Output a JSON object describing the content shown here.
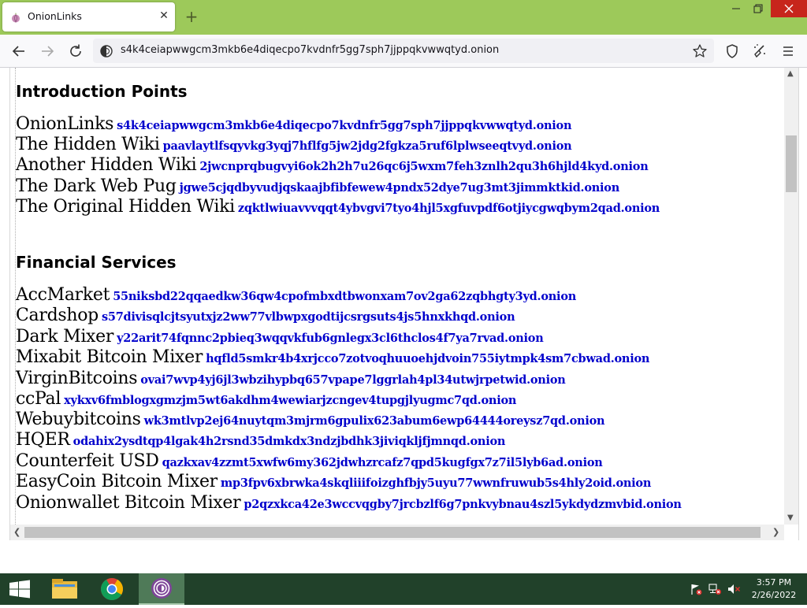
{
  "browser": {
    "tab_title": "OnionLinks",
    "url": "s4k4ceiapwwgcm3mkb6e4diqecpo7kvdnfr5gg7sph7jjppqkvwwqtyd.onion"
  },
  "sections": [
    {
      "heading": "Introduction Points",
      "entries": [
        {
          "name": "OnionLinks",
          "link": "s4k4ceiapwwgcm3mkb6e4diqecpo7kvdnfr5gg7sph7jjppqkvwwqtyd.onion"
        },
        {
          "name": "The Hidden Wiki",
          "link": "paavlaytlfsqyvkg3yqj7hflfg5jw2jdg2fgkza5ruf6lplwseeqtvyd.onion"
        },
        {
          "name": "Another Hidden Wiki",
          "link": "2jwcnprqbugvyi6ok2h2h7u26qc6j5wxm7feh3znlh2qu3h6hjld4kyd.onion"
        },
        {
          "name": "The Dark Web Pug",
          "link": "jgwe5cjqdbyvudjqskaajbfibfewew4pndx52dye7ug3mt3jimmktkid.onion"
        },
        {
          "name": "The Original Hidden Wiki",
          "link": "zqktlwiuavvvqqt4ybvgvi7tyo4hjl5xgfuvpdf6otjiycgwqbym2qad.onion"
        }
      ]
    },
    {
      "heading": "Financial Services",
      "entries": [
        {
          "name": "AccMarket",
          "link": "55niksbd22qqaedkw36qw4cpofmbxdtbwonxam7ov2ga62zqbhgty3yd.onion"
        },
        {
          "name": "Cardshop",
          "link": "s57divisqlcjtsyutxjz2ww77vlbwpxgodtijcsrgsuts4js5hnxkhqd.onion"
        },
        {
          "name": "Dark Mixer",
          "link": "y22arit74fqnnc2pbieq3wqqvkfub6gnlegx3cl6thclos4f7ya7rvad.onion"
        },
        {
          "name": "Mixabit Bitcoin Mixer",
          "link": "hqfld5smkr4b4xrjcco7zotvoqhuuoehjdvoin755iytmpk4sm7cbwad.onion"
        },
        {
          "name": "VirginBitcoins",
          "link": "ovai7wvp4yj6jl3wbzihypbq657vpape7lggrlah4pl34utwjrpetwid.onion"
        },
        {
          "name": "ccPal",
          "link": "xykxv6fmblogxgmzjm5wt6akdhm4wewiarjzcngev4tupgjlyugmc7qd.onion"
        },
        {
          "name": "Webuybitcoins",
          "link": "wk3mtlvp2ej64nuytqm3mjrm6gpulix623abum6ewp64444oreysz7qd.onion"
        },
        {
          "name": "HQER",
          "link": "odahix2ysdtqp4lgak4h2rsnd35dmkdx3ndzjbdhk3jiviqkljfjmnqd.onion"
        },
        {
          "name": "Counterfeit USD",
          "link": "qazkxav4zzmt5xwfw6my362jdwhzrcafz7qpd5kugfgx7z7il5lyb6ad.onion"
        },
        {
          "name": "EasyCoin Bitcoin Mixer",
          "link": "mp3fpv6xbrwka4skqliiifoizghfbjy5uyu77wwnfruwub5s4hly2oid.onion"
        },
        {
          "name": "Onionwallet Bitcoin Mixer",
          "link": "p2qzxkca42e3wccvqgby7jrcbzlf6g7pnkvybnau4szl5ykdydzmvbid.onion"
        }
      ]
    }
  ],
  "taskbar": {
    "apps": [
      "file-explorer-icon",
      "chrome-icon",
      "tor-browser-icon"
    ],
    "time": "3:57 PM",
    "date": "2/26/2022"
  },
  "colors": {
    "tabbar_bg": "#9dc95a",
    "link": "#0000cc",
    "taskbar_bg": "#21412a",
    "close_button": "#c7251c"
  }
}
